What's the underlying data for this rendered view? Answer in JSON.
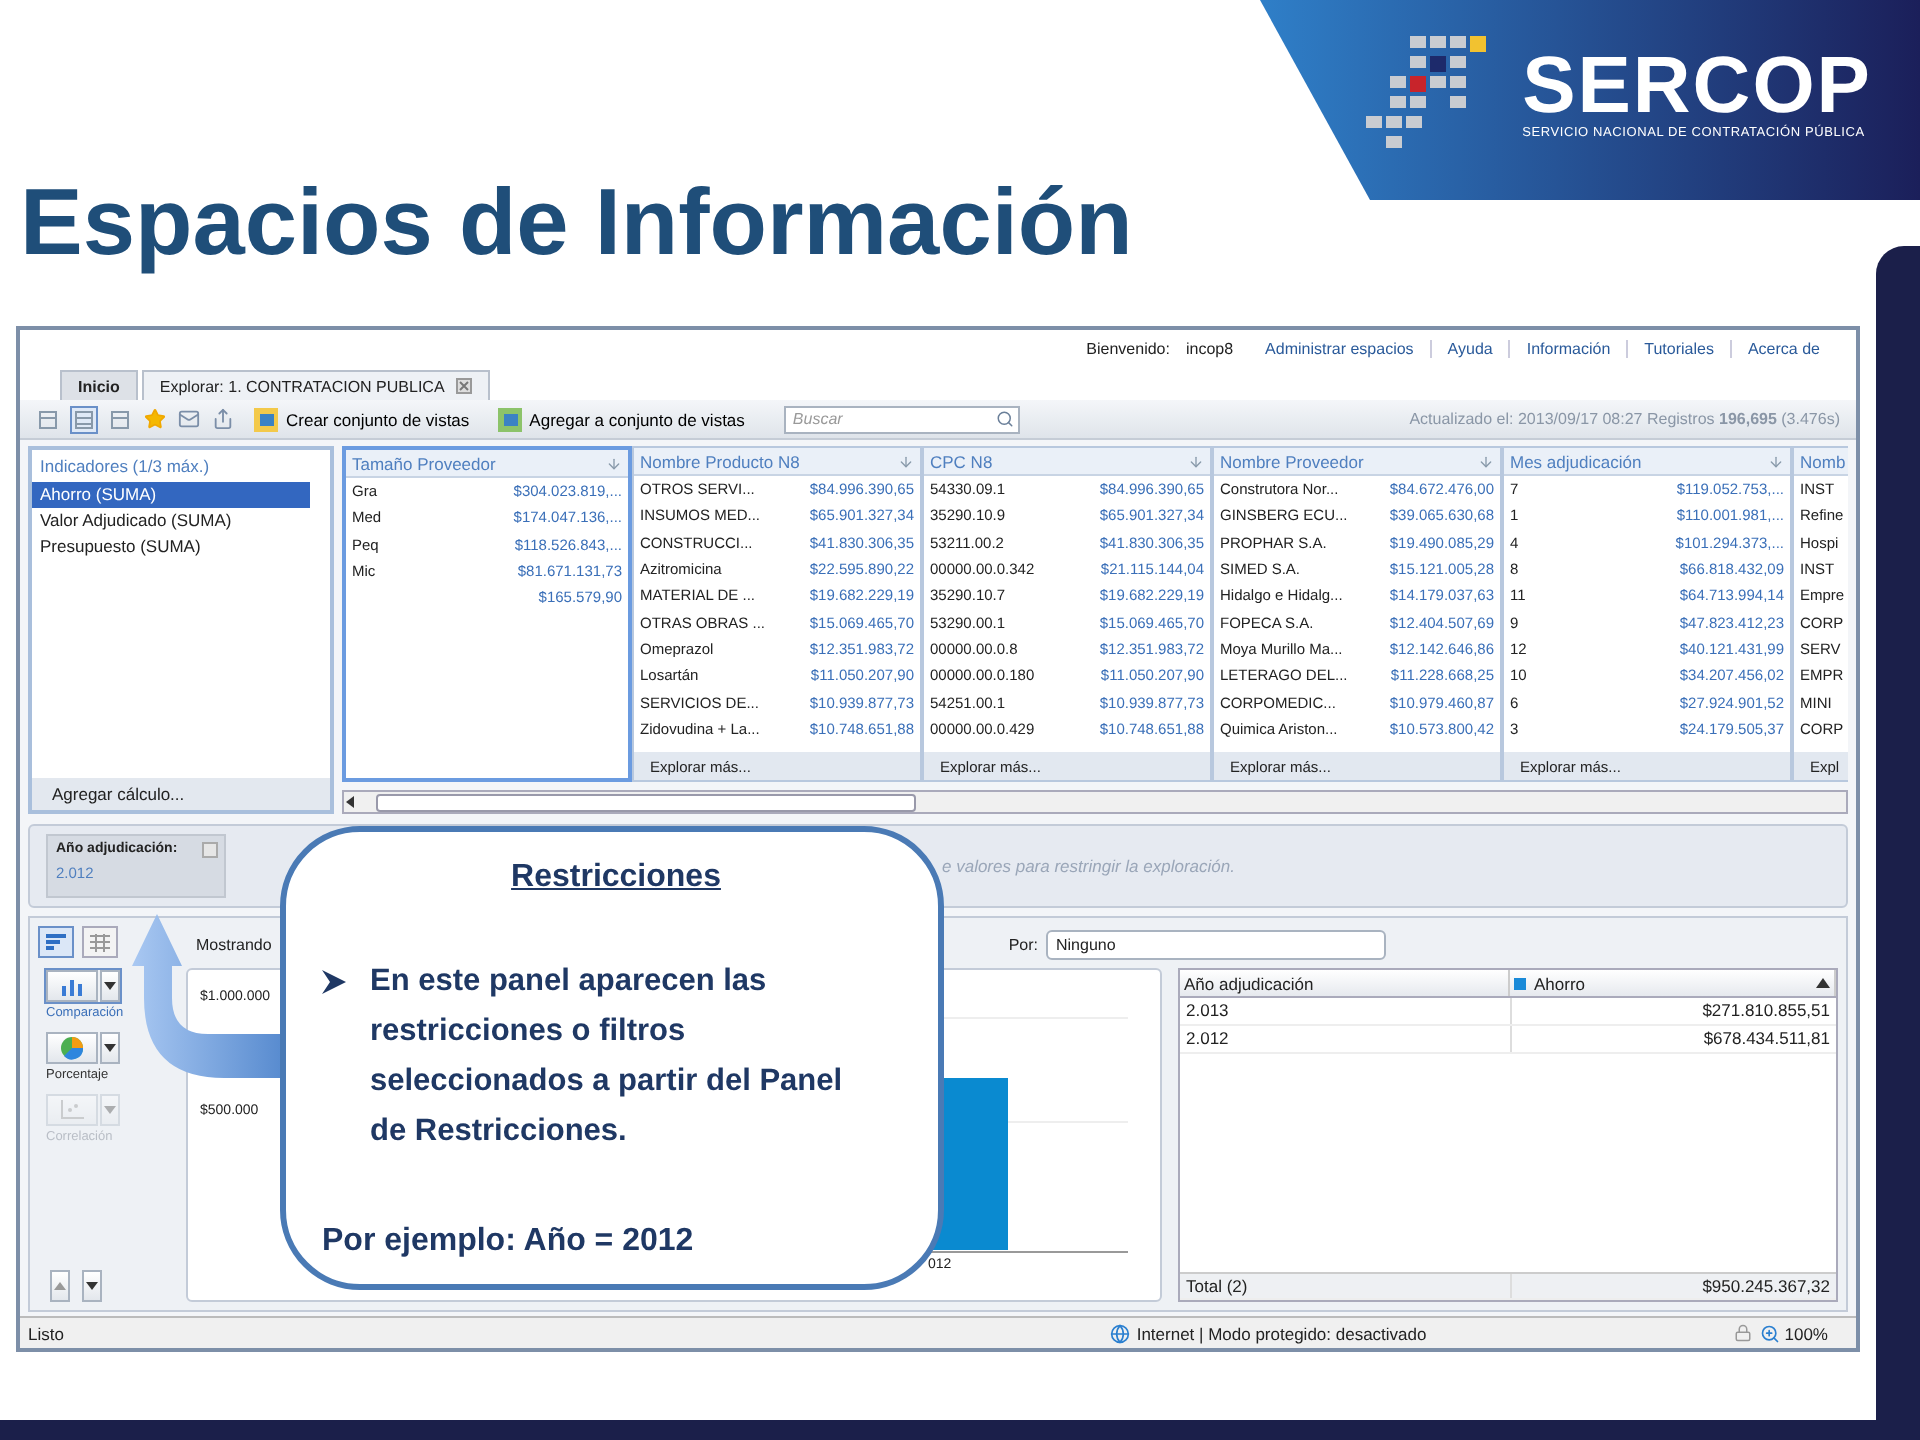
{
  "slide": {
    "title": "Espacios de Información",
    "logo": {
      "name": "SERCOP",
      "tagline": "SERVICIO NACIONAL DE CONTRATACIÓN PÚBLICA"
    }
  },
  "browser": {
    "top_links": {
      "welcome": "Bienvenido:",
      "user": "incop8",
      "links": [
        "Administrar espacios",
        "Ayuda",
        "Información",
        "Tutoriales",
        "Acerca de"
      ]
    },
    "tabs": [
      {
        "label": "Inicio",
        "selected": false,
        "closable": false
      },
      {
        "label": "Explorar: 1. CONTRATACION PUBLICA",
        "selected": true,
        "closable": true
      }
    ],
    "toolbar": {
      "layouts": [
        {
          "selected": false
        },
        {
          "selected": true
        },
        {
          "selected": false
        }
      ],
      "actions": [
        "Crear conjunto de vistas",
        "Agregar a conjunto de vistas"
      ],
      "search": {
        "placeholder": "Buscar"
      },
      "status": "Actualizado el: 2013/09/17 08:27 Registros **196,695** (3.476s)"
    },
    "indicators": {
      "title": "Indicadores (1/3 máx.)",
      "items": [
        {
          "label": "Ahorro (SUMA)",
          "selected": true
        },
        {
          "label": "Valor Adjudicado (SUMA)",
          "selected": false
        },
        {
          "label": "Presupuesto (SUMA)",
          "selected": false
        }
      ],
      "footer": "Agregar cálculo..."
    },
    "columns": [
      {
        "title": "Tamaño Proveedor",
        "selected": true,
        "rows": [
          {
            "label": "Gra",
            "value": "$304.023.819,..."
          },
          {
            "label": "Med",
            "value": "$174.047.136,..."
          },
          {
            "label": "Peq",
            "value": "$118.526.843,..."
          },
          {
            "label": "Mic",
            "value": "$81.671.131,73"
          },
          {
            "value": "$165.579,90"
          }
        ]
      },
      {
        "title": "Nombre Producto N8",
        "selected": false,
        "footer": "Explorar más...",
        "rows": [
          {
            "label": "OTROS SERVI...",
            "value": "$84.996.390,65"
          },
          {
            "label": "INSUMOS MED...",
            "value": "$65.901.327,34"
          },
          {
            "label": "CONSTRUCCI...",
            "value": "$41.830.306,35"
          },
          {
            "label": "Azitromicina",
            "value": "$22.595.890,22"
          },
          {
            "label": "MATERIAL DE ...",
            "value": "$19.682.229,19"
          },
          {
            "label": "OTRAS OBRAS ...",
            "value": "$15.069.465,70"
          },
          {
            "label": "Omeprazol",
            "value": "$12.351.983,72"
          },
          {
            "label": "Losartán",
            "value": "$11.050.207,90"
          },
          {
            "label": "SERVICIOS DE...",
            "value": "$10.939.877,73"
          },
          {
            "label": "Zidovudina + La...",
            "value": "$10.748.651,88"
          }
        ]
      },
      {
        "title": "CPC N8",
        "selected": false,
        "footer": "Explorar más...",
        "rows": [
          {
            "label": "54330.09.1",
            "value": "$84.996.390,65"
          },
          {
            "label": "35290.10.9",
            "value": "$65.901.327,34"
          },
          {
            "label": "53211.00.2",
            "value": "$41.830.306,35"
          },
          {
            "label": "00000.00.0.342",
            "value": "$21.115.144,04"
          },
          {
            "label": "35290.10.7",
            "value": "$19.682.229,19"
          },
          {
            "label": "53290.00.1",
            "value": "$15.069.465,70"
          },
          {
            "label": "00000.00.0.8",
            "value": "$12.351.983,72"
          },
          {
            "label": "00000.00.0.180",
            "value": "$11.050.207,90"
          },
          {
            "label": "54251.00.1",
            "value": "$10.939.877,73"
          },
          {
            "label": "00000.00.0.429",
            "value": "$10.748.651,88"
          }
        ]
      },
      {
        "title": "Nombre Proveedor",
        "selected": false,
        "footer": "Explorar más...",
        "rows": [
          {
            "label": "Construtora Nor...",
            "value": "$84.672.476,00"
          },
          {
            "label": "GINSBERG ECU...",
            "value": "$39.065.630,68"
          },
          {
            "label": "PROPHAR S.A.",
            "value": "$19.490.085,29"
          },
          {
            "label": "SIMED S.A.",
            "value": "$15.121.005,28"
          },
          {
            "label": "Hidalgo e Hidalg...",
            "value": "$14.179.037,63"
          },
          {
            "label": "FOPECA S.A.",
            "value": "$12.404.507,69"
          },
          {
            "label": "Moya Murillo Ma...",
            "value": "$12.142.646,86"
          },
          {
            "label": "LETERAGO DEL...",
            "value": "$11.228.668,25"
          },
          {
            "label": "CORPOMEDIC...",
            "value": "$10.979.460,87"
          },
          {
            "label": "Quimica Ariston...",
            "value": "$10.573.800,42"
          }
        ]
      },
      {
        "title": "Mes adjudicación",
        "selected": false,
        "footer": "Explorar más...",
        "rows": [
          {
            "label": "7",
            "value": "$119.052.753,..."
          },
          {
            "label": "1",
            "value": "$110.001.981,..."
          },
          {
            "label": "4",
            "value": "$101.294.373,..."
          },
          {
            "label": "8",
            "value": "$66.818.432,09"
          },
          {
            "label": "11",
            "value": "$64.713.994,14"
          },
          {
            "label": "9",
            "value": "$47.823.412,23"
          },
          {
            "label": "12",
            "value": "$40.121.431,99"
          },
          {
            "label": "10",
            "value": "$34.207.456,02"
          },
          {
            "label": "6",
            "value": "$27.924.901,52"
          },
          {
            "label": "3",
            "value": "$24.179.505,37"
          }
        ]
      },
      {
        "title": "Nomb",
        "selected": false,
        "footer": "Expl",
        "rows": [
          {
            "label": "INST"
          },
          {
            "label": "Refine"
          },
          {
            "label": "Hospi"
          },
          {
            "label": "INST"
          },
          {
            "label": "Empre"
          },
          {
            "label": "CORP"
          },
          {
            "label": "SERV"
          },
          {
            "label": "EMPR"
          },
          {
            "label": "MINI"
          },
          {
            "label": "CORP"
          }
        ]
      }
    ],
    "restrictions": {
      "chips": [
        {
          "label": "Año adjudicación:",
          "value": "2.012"
        }
      ],
      "hint": "e valores para restringir la exploración."
    },
    "view": {
      "modes": [
        {
          "selected": true
        },
        {
          "selected": false
        }
      ],
      "chart_types": [
        {
          "kind": "bar",
          "label": "Comparación",
          "selected": true,
          "disabled": false
        },
        {
          "kind": "pie",
          "label": "Porcentaje",
          "selected": false,
          "disabled": false
        },
        {
          "kind": "scatter",
          "label": "Correlación",
          "selected": false,
          "disabled": true
        }
      ],
      "showing": "Mostrando",
      "by_label": "Por:",
      "by_value": "Ninguno",
      "y_labels": [
        "$1.000.000",
        "$500.000"
      ],
      "x_label": "012",
      "table": {
        "columns": [
          "Año adjudicación",
          "Ahorro"
        ],
        "rows": [
          [
            "2.013",
            "$271.810.855,51"
          ],
          [
            "2.012",
            "$678.434.511,81"
          ]
        ],
        "total": [
          "Total (2)",
          "$950.245.367,32"
        ]
      }
    },
    "status_bar": {
      "text": "Listo",
      "zone": "Internet | Modo protegido: desactivado",
      "zoom": "100%"
    }
  },
  "callout": {
    "title": "Restricciones",
    "bullet": "En este panel  aparecen las restricciones o filtros seleccionados a partir del Panel de Restricciones.",
    "example": "Por ejemplo: Año = 2012"
  }
}
